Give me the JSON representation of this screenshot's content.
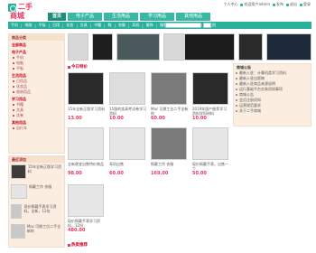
{
  "logo": {
    "line1": "二手",
    "line2": "商城"
  },
  "top_links": [
    "个人中心",
    "欢迎用户admin",
    "发布",
    "退出",
    "登录"
  ],
  "nav": [
    "首页",
    "电子产品",
    "生活用品",
    "学习用品",
    "其他用品"
  ],
  "subbar": {
    "links": [
      "手机",
      "电脑",
      "平板",
      "日用",
      "化妆",
      "文具",
      "书籍",
      "鞋",
      "衣服",
      "耳机",
      "服饰",
      "服装",
      "个人学习",
      "运动",
      "其他"
    ],
    "search_placeholder": "",
    "search_label": "搜索"
  },
  "sidebar": {
    "title": "商品分类",
    "categories": [
      {
        "title": "全部商品",
        "items": []
      },
      {
        "title": "电子产品",
        "items": [
          "手机",
          "电脑",
          "平板"
        ]
      },
      {
        "title": "生活用品",
        "items": [
          "日用品",
          "化妆品",
          "收纳用品"
        ]
      },
      {
        "title": "学习用品",
        "items": [
          "书籍",
          "文具",
          "试卷"
        ]
      },
      {
        "title": "其他用品",
        "items": [
          "自行车"
        ]
      }
    ]
  },
  "recommend": {
    "title": "最近添加",
    "items": [
      {
        "name": "15年全新正版学习资料",
        "price": ""
      },
      {
        "name": "佩戴工作 衣服",
        "price": ""
      },
      {
        "name": "现价佩戴手表学习资料，全新，12份",
        "price": ""
      },
      {
        "name": "Mac 可换工位二手全新的",
        "price": ""
      }
    ]
  },
  "sections": [
    {
      "title": "今日特价",
      "products": [
        {
          "name": "15年全新正版学习资料",
          "price": "13.00"
        },
        {
          "name": "15版的卖高考试卷学习资料",
          "price": "10.00"
        },
        {
          "name": "Mac 可换工位二手全新的",
          "price": "60.00"
        },
        {
          "name": "2019年国产推荐学习资料学科材料",
          "price": "10.00"
        },
        {
          "name": "全新便宜出售特价商品",
          "price": "98.00"
        },
        {
          "name": "耳机出售",
          "price": "60.00"
        },
        {
          "name": "佩戴工作 衣服",
          "price": "169.00"
        },
        {
          "name": "现价佩戴手表，出售一个",
          "price": "50.00"
        },
        {
          "name": "现价佩戴手表学习资料，12份",
          "price": "480.00"
        }
      ]
    },
    {
      "title": "热卖推荐",
      "products": []
    }
  ],
  "right_box": {
    "title": "商城公告",
    "items": [
      "最新入驻：计算机类学习资料",
      "最新入驻出版物",
      "最新入驻商品来源说明",
      "运行基础平台交易须知事项",
      "商城公告",
      "会员注册须知",
      "运营规范要求",
      "关于二手商城"
    ]
  }
}
